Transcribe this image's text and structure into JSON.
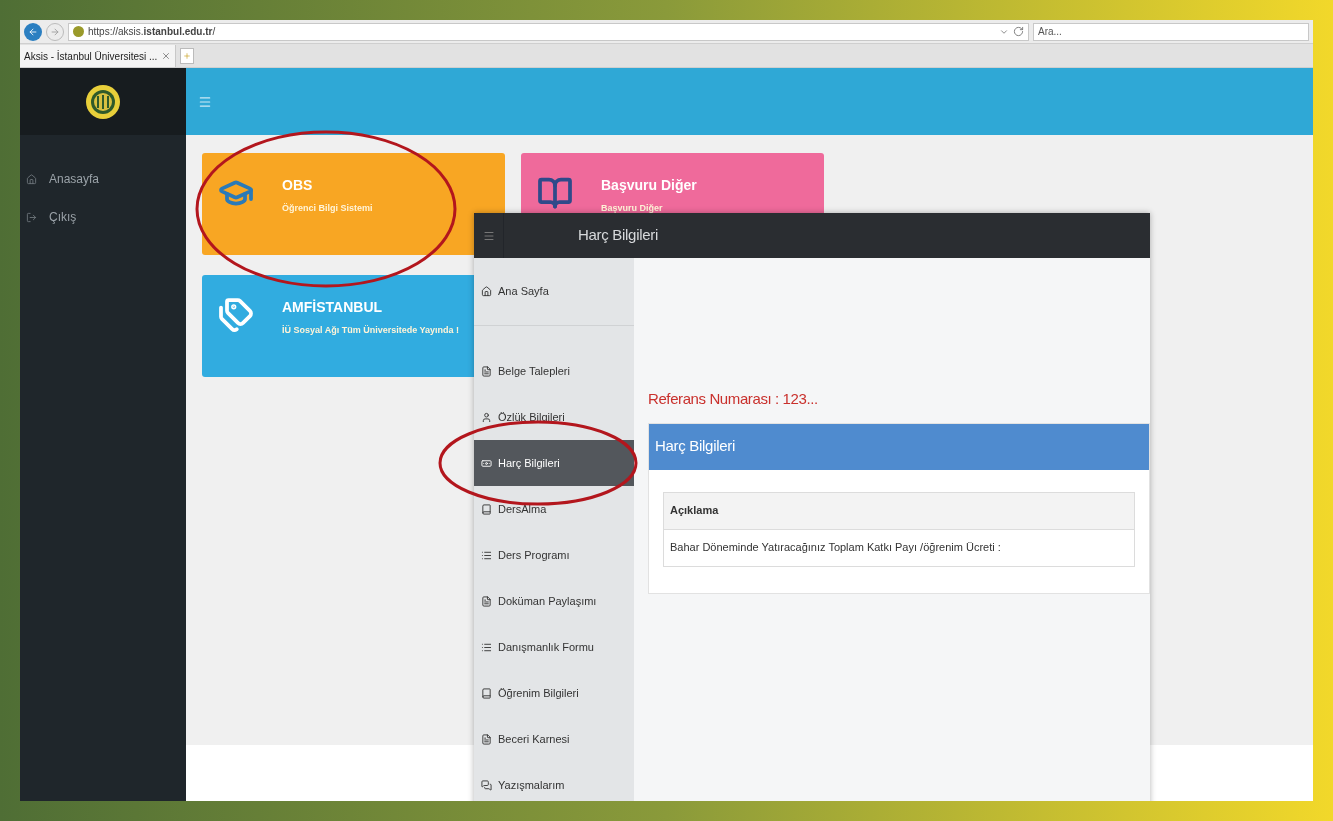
{
  "browser": {
    "url": "https://aksis.**istanbul.edu.tr**/",
    "search": {
      "placeholder": "Ara..."
    },
    "tab": "Aksis - İstanbul Üniversitesi ..."
  },
  "site": {
    "sidebar": {
      "items": [
        {
          "label": "Anasayfa"
        },
        {
          "label": "Çıkış"
        }
      ]
    },
    "tiles": [
      {
        "title": "OBS",
        "subtitle": "Öğrenci Bilgi Sistemi",
        "color": "#f8a623",
        "circled": true
      },
      {
        "title": "Başvuru Diğer",
        "subtitle": "Başvuru Diğer",
        "color": "#ef6a9b",
        "circled": false
      },
      {
        "title": "AMFİSTANBUL",
        "subtitle": "İÜ Sosyal Ağı Tüm Üniversitede Yayında !",
        "color": "#31ace0",
        "circled": false
      }
    ]
  },
  "overlay": {
    "title": "Harç Bilgileri",
    "menu": [
      {
        "label": "Ana Sayfa",
        "selected": false,
        "circled": false
      },
      {
        "label": "Belge Talepleri",
        "selected": false,
        "circled": false
      },
      {
        "label": "Özlük Bilgileri",
        "selected": false,
        "circled": false
      },
      {
        "label": "Harç Bilgileri",
        "selected": true,
        "circled": true
      },
      {
        "label": "DersAlma",
        "selected": false,
        "circled": false
      },
      {
        "label": "Ders Programı",
        "selected": false,
        "circled": false
      },
      {
        "label": "Doküman Paylaşımı",
        "selected": false,
        "circled": false
      },
      {
        "label": "Danışmanlık Formu",
        "selected": false,
        "circled": false
      },
      {
        "label": "Öğrenim Bilgileri",
        "selected": false,
        "circled": false
      },
      {
        "label": "Beceri Karnesi",
        "selected": false,
        "circled": false
      },
      {
        "label": "Yazışmalarım",
        "selected": false,
        "circled": false
      }
    ],
    "reference": "Referans Numarası : 123...",
    "panel": {
      "title": "Harç Bilgileri",
      "table": {
        "columns": [
          "Açıklama"
        ],
        "rows": [
          [
            "Bahar Döneminde Yatıracağınız Toplam Katkı Payı /öğrenim Ücreti :"
          ]
        ]
      }
    }
  }
}
